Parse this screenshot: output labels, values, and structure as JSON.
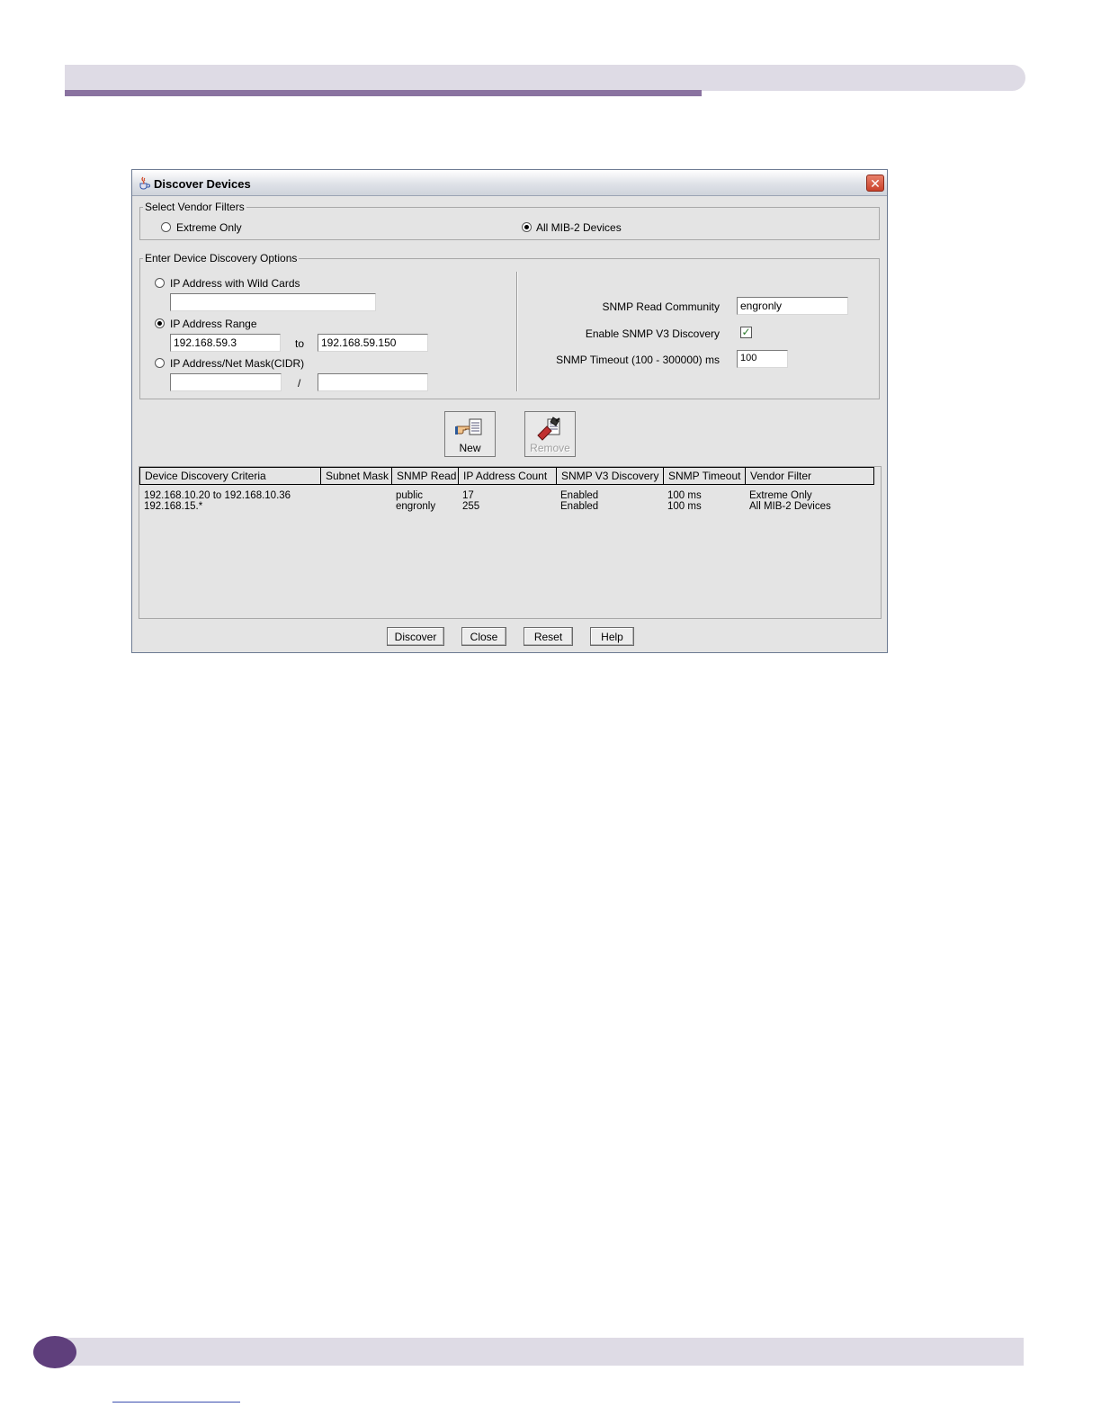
{
  "dialog": {
    "title": "Discover Devices",
    "close_glyph": "✕"
  },
  "vendor_filters": {
    "legend": "Select Vendor Filters",
    "options": [
      {
        "label": "Extreme Only",
        "selected": false
      },
      {
        "label": "All MIB-2 Devices",
        "selected": true
      }
    ]
  },
  "discovery_options": {
    "legend": "Enter Device Discovery Options",
    "wildcard": {
      "label": "IP Address with Wild Cards",
      "selected": false,
      "value": ""
    },
    "range": {
      "label": "IP Address Range",
      "selected": true,
      "from": "192.168.59.3",
      "to_label": "to",
      "to": "192.168.59.150"
    },
    "cidr": {
      "label": "IP Address/Net Mask(CIDR)",
      "selected": false,
      "address": "",
      "separator": "/",
      "mask": ""
    },
    "snmp_read_community": {
      "label": "SNMP Read Community",
      "value": "engronly"
    },
    "snmp_v3": {
      "label": "Enable SNMP V3 Discovery",
      "checked": true,
      "check_glyph": "✓"
    },
    "snmp_timeout": {
      "label": "SNMP Timeout (100 - 300000) ms",
      "value": "100"
    }
  },
  "toolbar": {
    "new_label": "New",
    "remove_label": "Remove"
  },
  "table": {
    "columns": [
      "Device Discovery Criteria",
      "Subnet Mask",
      "SNMP Read",
      "IP Address Count",
      "SNMP V3 Discovery",
      "SNMP Timeout",
      "Vendor Filter"
    ],
    "rows": [
      [
        "192.168.10.20 to 192.168.10.36",
        "",
        "public",
        "17",
        "Enabled",
        "100 ms",
        "Extreme Only"
      ],
      [
        "192.168.15.*",
        "",
        "engronly",
        "255",
        "Enabled",
        "100 ms",
        "All MIB-2 Devices"
      ]
    ]
  },
  "buttons": {
    "discover": "Discover",
    "close": "Close",
    "reset": "Reset",
    "help": "Help"
  },
  "colors": {
    "header_purple": "#8a72a0",
    "header_band": "#dedbe5",
    "footer_circle": "#5f3f7c"
  }
}
